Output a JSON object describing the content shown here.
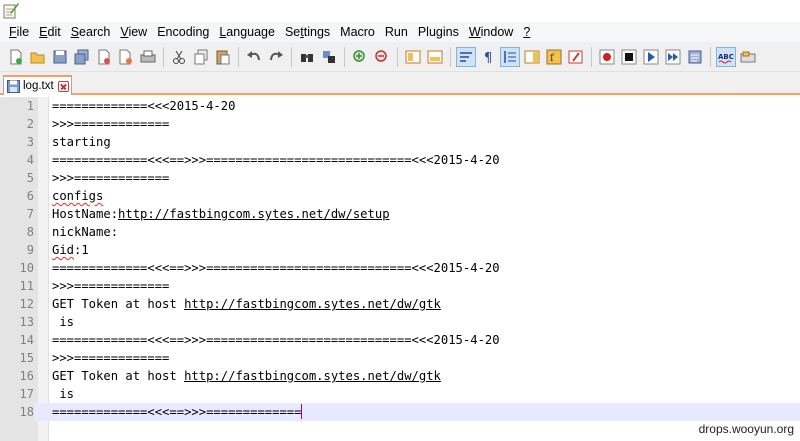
{
  "menu": {
    "items": [
      {
        "label": "File",
        "accel": "F"
      },
      {
        "label": "Edit",
        "accel": "E"
      },
      {
        "label": "Search",
        "accel": "S"
      },
      {
        "label": "View",
        "accel": "V"
      },
      {
        "label": "Encoding",
        "accel": ""
      },
      {
        "label": "Language",
        "accel": "L"
      },
      {
        "label": "Settings",
        "accel": "t"
      },
      {
        "label": "Macro",
        "accel": ""
      },
      {
        "label": "Run",
        "accel": ""
      },
      {
        "label": "Plugins",
        "accel": ""
      },
      {
        "label": "Window",
        "accel": "W"
      },
      {
        "label": "?",
        "accel": "?"
      }
    ]
  },
  "toolbar": {
    "icons": [
      "new-file-icon",
      "open-file-icon",
      "save-icon",
      "save-all-icon",
      "close-icon",
      "close-all-icon",
      "print-icon",
      "cut-icon",
      "copy-icon",
      "paste-icon",
      "undo-icon",
      "redo-icon",
      "find-icon",
      "replace-icon",
      "zoom-in-icon",
      "zoom-out-icon",
      "sync-vertical-icon",
      "sync-horizontal-icon",
      "word-wrap-icon",
      "show-all-chars-icon",
      "indent-guide-icon",
      "document-map-icon",
      "function-list-icon",
      "folder-workspace-icon",
      "record-macro-icon",
      "stop-recording-icon",
      "play-macro-icon",
      "run-macro-multiple-icon",
      "save-macro-icon",
      "spell-check-icon",
      "spell-check-options-icon"
    ]
  },
  "tab": {
    "label": "log.txt"
  },
  "editor": {
    "lines": [
      {
        "num": "1",
        "segments": [
          {
            "t": "=============<<<2015-4-20",
            "s": ""
          }
        ]
      },
      {
        "num": "2",
        "segments": [
          {
            "t": ">>>=============",
            "s": ""
          }
        ]
      },
      {
        "num": "3",
        "segments": [
          {
            "t": "starting",
            "s": ""
          }
        ]
      },
      {
        "num": "4",
        "segments": [
          {
            "t": "=============<<<==>>>============================<<<2015-4-20",
            "s": ""
          }
        ]
      },
      {
        "num": "5",
        "segments": [
          {
            "t": ">>>=============",
            "s": ""
          }
        ]
      },
      {
        "num": "6",
        "segments": [
          {
            "t": "configs",
            "s": "squiggle"
          }
        ]
      },
      {
        "num": "7",
        "segments": [
          {
            "t": "HostName:",
            "s": ""
          },
          {
            "t": "http://fastbingcom.sytes.net/dw/setup",
            "s": "link"
          }
        ]
      },
      {
        "num": "8",
        "segments": [
          {
            "t": "nickName:",
            "s": ""
          }
        ]
      },
      {
        "num": "9",
        "segments": [
          {
            "t": "Gid",
            "s": "squiggle"
          },
          {
            "t": ":1",
            "s": ""
          }
        ]
      },
      {
        "num": "10",
        "segments": [
          {
            "t": "=============<<<==>>>============================<<<2015-4-20",
            "s": ""
          }
        ]
      },
      {
        "num": "11",
        "segments": [
          {
            "t": ">>>=============",
            "s": ""
          }
        ]
      },
      {
        "num": "12",
        "segments": [
          {
            "t": "GET Token at host ",
            "s": ""
          },
          {
            "t": "http://fastbingcom.sytes.net/dw/gtk",
            "s": "link"
          }
        ]
      },
      {
        "num": "13",
        "segments": [
          {
            "t": " is",
            "s": ""
          }
        ]
      },
      {
        "num": "14",
        "segments": [
          {
            "t": "=============<<<==>>>============================<<<2015-4-20",
            "s": ""
          }
        ]
      },
      {
        "num": "15",
        "segments": [
          {
            "t": ">>>=============",
            "s": ""
          }
        ]
      },
      {
        "num": "16",
        "segments": [
          {
            "t": "GET Token at host ",
            "s": ""
          },
          {
            "t": "http://fastbingcom.sytes.net/dw/gtk",
            "s": "link"
          }
        ]
      },
      {
        "num": "17",
        "segments": [
          {
            "t": " is",
            "s": ""
          }
        ]
      },
      {
        "num": "18",
        "segments": [
          {
            "t": "=============<<<==>>>=============",
            "s": ""
          }
        ],
        "current": true
      }
    ]
  },
  "watermark": "drops.wooyun.org"
}
